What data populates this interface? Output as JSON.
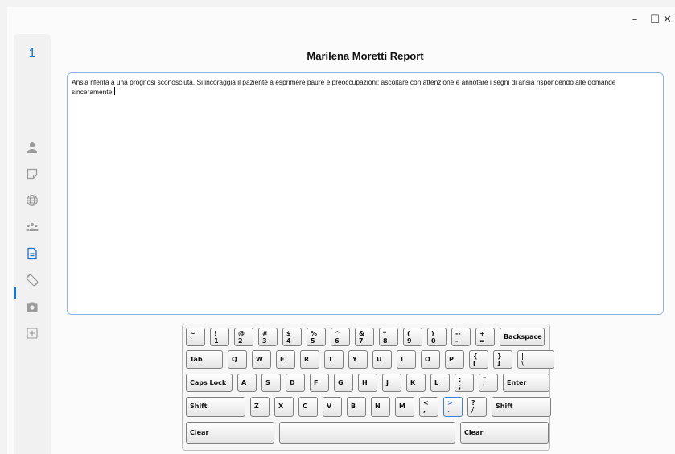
{
  "window": {
    "min_glyph": "–",
    "max_glyph": "☐",
    "close_glyph": "✕"
  },
  "sidebar": {
    "number": "1",
    "active_index": 4
  },
  "report": {
    "title": "Marilena Moretti Report",
    "text": "Ansia riferita a una prognosi sconosciuta. Si incoraggia il paziente a esprimere paure e preoccupazioni; ascoltare con attenzione e annotare i segni di ansia rispondendo alle domande sinceramente."
  },
  "keyboard": {
    "row1": [
      {
        "up": "~",
        "dn": "`"
      },
      {
        "up": "!",
        "dn": "1"
      },
      {
        "up": "@",
        "dn": "2"
      },
      {
        "up": "#",
        "dn": "3"
      },
      {
        "up": "$",
        "dn": "4"
      },
      {
        "up": "%",
        "dn": "5"
      },
      {
        "up": "^",
        "dn": "6"
      },
      {
        "up": "&",
        "dn": "7"
      },
      {
        "up": "*",
        "dn": "8"
      },
      {
        "up": "(",
        "dn": "9"
      },
      {
        "up": ")",
        "dn": "0"
      },
      {
        "up": "--",
        "dn": "-"
      },
      {
        "up": "+",
        "dn": "="
      },
      {
        "label": "Backspace"
      }
    ],
    "row2": [
      {
        "label": "Tab"
      },
      {
        "label": "Q"
      },
      {
        "label": "W"
      },
      {
        "label": "E"
      },
      {
        "label": "R"
      },
      {
        "label": "T"
      },
      {
        "label": "Y"
      },
      {
        "label": "U"
      },
      {
        "label": "I"
      },
      {
        "label": "O"
      },
      {
        "label": "P"
      },
      {
        "up": "{",
        "dn": "["
      },
      {
        "up": "}",
        "dn": "]"
      },
      {
        "up": "|",
        "dn": "\\"
      }
    ],
    "row3": [
      {
        "label": "Caps Lock"
      },
      {
        "label": "A"
      },
      {
        "label": "S"
      },
      {
        "label": "D"
      },
      {
        "label": "F"
      },
      {
        "label": "G"
      },
      {
        "label": "H"
      },
      {
        "label": "J"
      },
      {
        "label": "K"
      },
      {
        "label": "L"
      },
      {
        "up": ":",
        "dn": ";"
      },
      {
        "up": "\"",
        "dn": "'"
      },
      {
        "label": "Enter"
      }
    ],
    "row4": [
      {
        "label": "Shift"
      },
      {
        "label": "Z"
      },
      {
        "label": "X"
      },
      {
        "label": "C"
      },
      {
        "label": "V"
      },
      {
        "label": "B"
      },
      {
        "label": "N"
      },
      {
        "label": "M"
      },
      {
        "up": "<",
        "dn": ","
      },
      {
        "up": ">",
        "dn": ".",
        "focused": true
      },
      {
        "up": "?",
        "dn": "/"
      },
      {
        "label": "Shift"
      }
    ],
    "row5": [
      {
        "label": "Clear"
      },
      {
        "label": ""
      },
      {
        "label": "Clear"
      }
    ]
  }
}
